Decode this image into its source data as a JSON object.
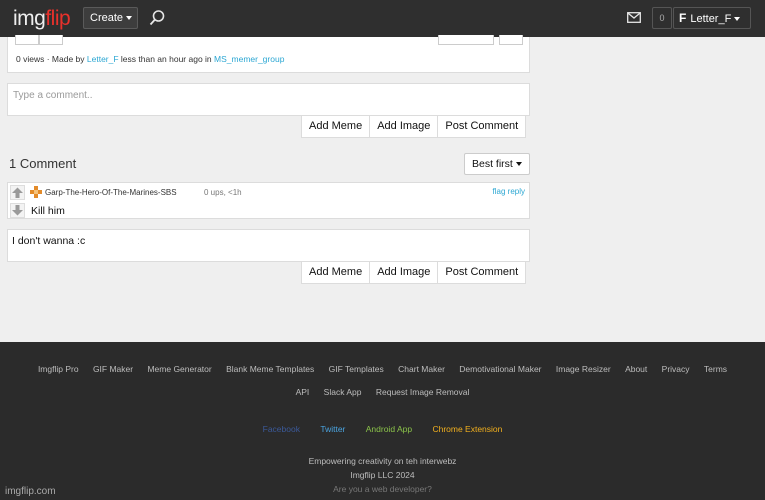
{
  "header": {
    "logo_part1": "img",
    "logo_part2": "flip",
    "create_label": "Create",
    "notifications": "0",
    "username": "Letter_F",
    "user_initial": "F"
  },
  "meta": {
    "views": "0 views",
    "made_by": "· Made by",
    "author": "Letter_F",
    "time": "less than an hour ago in",
    "stream": "MS_memer_group"
  },
  "comment_form_1": {
    "placeholder": "Type a comment..",
    "buttons": [
      "Add Meme",
      "Add Image",
      "Post Comment"
    ]
  },
  "comments_section": {
    "title": "1 Comment",
    "sort": "Best first"
  },
  "comment": {
    "author": "Garp-The-Hero-Of-The-Marines-SBS",
    "meta": "0 ups, <1h",
    "flag": "flag",
    "reply": "reply",
    "text": "Kill him"
  },
  "comment_form_2": {
    "value": "I don't wanna :c",
    "buttons": [
      "Add Meme",
      "Add Image",
      "Post Comment"
    ]
  },
  "footer": {
    "links_row1": [
      "Imgflip Pro",
      "GIF Maker",
      "Meme Generator",
      "Blank Meme Templates",
      "GIF Templates",
      "Chart Maker",
      "Demotivational Maker",
      "Image Resizer",
      "About",
      "Privacy",
      "Terms"
    ],
    "links_row2": [
      "API",
      "Slack App",
      "Request Image Removal"
    ],
    "social": [
      "Facebook",
      "Twitter",
      "Android App",
      "Chrome Extension"
    ],
    "tagline": "Empowering creativity on teh interwebz",
    "copyright": "Imgflip LLC 2024",
    "dev": "Are you a web developer?"
  },
  "watermark": "imgflip.com",
  "colors": {
    "topbar": "#2f2f2f",
    "logo_accent": "#e9312b",
    "link": "#2ca7d3",
    "facebook": "#3b5998",
    "twitter": "#4aa3df",
    "android": "#8bc34a",
    "chrome": "#f2b01e"
  }
}
